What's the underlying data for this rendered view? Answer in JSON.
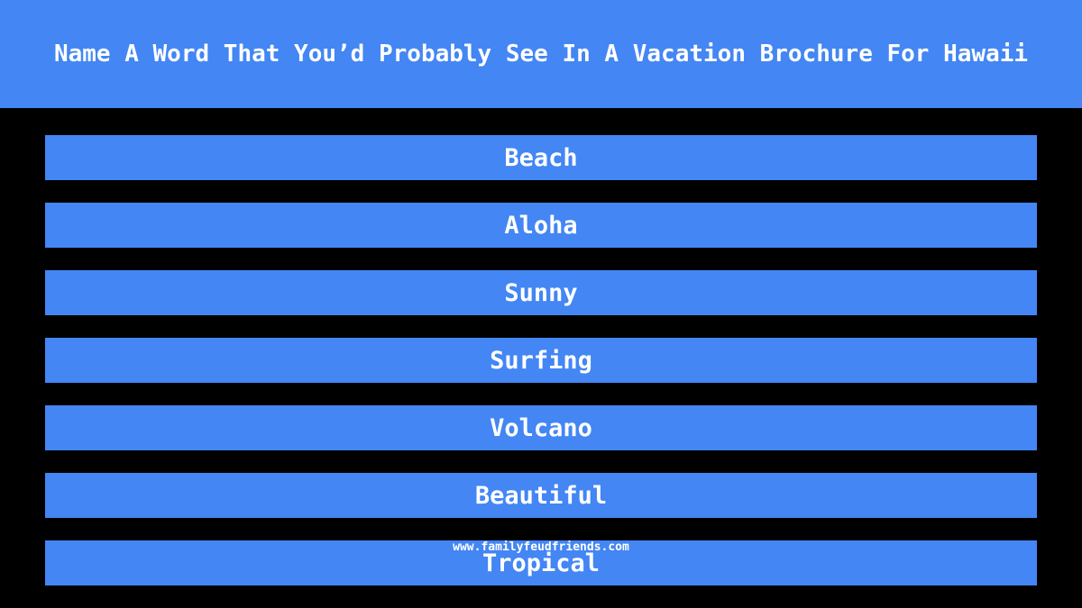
{
  "header": {
    "title": "Name A Word That You’d Probably See In A Vacation Brochure For Hawaii"
  },
  "answers": [
    "Beach",
    "Aloha",
    "Sunny",
    "Surfing",
    "Volcano",
    "Beautiful",
    "Tropical"
  ],
  "footer": {
    "url": "www.familyfeudfriends.com"
  },
  "colors": {
    "accent": "#4386f4",
    "background": "#000000",
    "text": "#ffffff"
  }
}
